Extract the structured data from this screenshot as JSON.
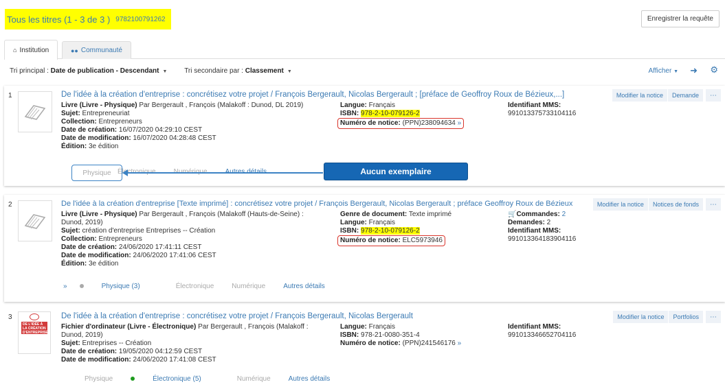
{
  "header": {
    "title": "Tous les titres (1 - 3 de 3 )",
    "isbn": "9782100791262",
    "save_label": "Enregistrer la requête"
  },
  "tabs": [
    {
      "label": "Institution",
      "icon": "home-icon"
    },
    {
      "label": "Communauté",
      "icon": "users-icon"
    }
  ],
  "sort": {
    "primary_label": "Tri principal : ",
    "primary_value": "Date de publication - Descendant",
    "secondary_label": "Tri secondaire par : ",
    "secondary_value": "Classement",
    "afficher": "Afficher"
  },
  "records": [
    {
      "num": "1",
      "title": "De l'idée à la création d'entreprise : concrétisez votre projet / François Bergerault, Nicolas Bergerault ; [préface de Geoffroy Roux de Bézieux,...]",
      "type": "Livre (Livre - Physique)",
      "by": " Par Bergerault , François (Malakoff : Dunod, DL 2019)",
      "sujet_label": "Sujet:",
      "sujet": " Entrepreneuriat",
      "collection_label": "Collection:",
      "collection": " Entrepreneurs",
      "creation_label": "Date de création:",
      "creation": " 16/07/2020 04:29:10 CEST",
      "modif_label": "Date de modification:",
      "modif": " 16/07/2020 04:28:48 CEST",
      "edition_label": "Édition:",
      "edition": " 3e édition",
      "langue_label": "Langue:",
      "langue": " Français",
      "isbn_label": "ISBN:",
      "isbn": "978-2-10-079126-2",
      "notice_label": "Numéro de notice:",
      "notice": " (PPN)238094634",
      "mms_label": "Identifiant MMS:",
      "mms": "991013375733104116",
      "actions": [
        "Modifier la notice",
        "Demande"
      ],
      "links": [
        "Physique",
        "Électronique",
        "Numérique",
        "Autres détails"
      ],
      "callout": "Aucun exemplaire"
    },
    {
      "num": "2",
      "title": "De l'idée à la création d'entreprise [Texte imprimé] : concrétisez votre projet / François Bergerault, Nicolas Bergerault ; préface Geoffroy Roux de Bézieux",
      "type": "Livre (Livre - Physique)",
      "by": " Par Bergerault , François (Malakoff (Hauts-de-Seine) : Dunod, 2019)",
      "sujet_label": "Sujet:",
      "sujet": " création d'entreprise Entreprises -- Création",
      "collection_label": "Collection:",
      "collection": " Entrepreneurs",
      "creation_label": "Date de création:",
      "creation": " 24/06/2020 17:41:11 CEST",
      "modif_label": "Date de modification:",
      "modif": " 24/06/2020 17:41:06 CEST",
      "edition_label": "Édition:",
      "edition": " 3e édition",
      "genre_label": "Genre de document:",
      "genre": " Texte imprimé",
      "langue_label": "Langue:",
      "langue": " Français",
      "isbn_label": "ISBN:",
      "isbn": "978-2-10-079126-2",
      "notice_label": "Numéro de notice:",
      "notice": " ELC5973946",
      "commandes_label": "Commandes:",
      "commandes": " 2",
      "demandes_label": "Demandes:",
      "demandes": " 2",
      "mms_label": "Identifiant MMS:",
      "mms": "991013364183904116",
      "actions": [
        "Modifier la notice",
        "Notices de fonds"
      ],
      "links": [
        "Physique (3)",
        "Électronique",
        "Numérique",
        "Autres détails"
      ]
    },
    {
      "num": "3",
      "title": "De l'idée à la création d'entreprise : concrétisez votre projet / François Bergerault, Nicolas Bergerault",
      "type": "Fichier d'ordinateur (Livre - Électronique)",
      "by": " Par Bergerault , François (Malakoff : Dunod, 2019)",
      "sujet_label": "Sujet:",
      "sujet": " Entreprises -- Création",
      "creation_label": "Date de création:",
      "creation": " 19/05/2020 04:12:59 CEST",
      "modif_label": "Date de modification:",
      "modif": " 24/06/2020 17:41:08 CEST",
      "langue_label": "Langue:",
      "langue": " Français",
      "isbn_label": "ISBN:",
      "isbn": " 978-21-0080-351-4",
      "notice_label": "Numéro de notice:",
      "notice": " (PPN)241546176",
      "mms_label": "Identifiant MMS:",
      "mms": "991013346652704116",
      "actions": [
        "Modifier la notice",
        "Portfolios"
      ],
      "links": [
        "Physique",
        "Électronique (5)",
        "Numérique",
        "Autres détails"
      ],
      "cover_text": "DE L'IDÉE À LA CRÉATION D'ENTREPRISE"
    }
  ],
  "colors": {
    "link": "#3b7ab3",
    "highlight": "#ffff00",
    "callout": "#1667b4",
    "redbox": "#d9342b",
    "green": "#1e9b1e"
  }
}
